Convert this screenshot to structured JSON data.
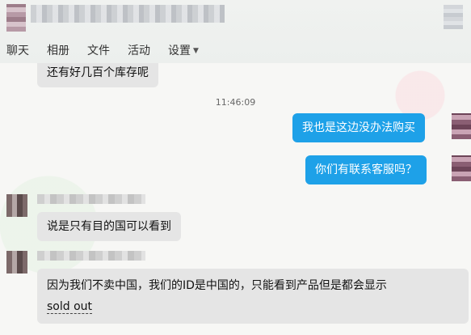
{
  "tabs": [
    "聊天",
    "相册",
    "文件",
    "活动",
    "设置"
  ],
  "time": "11:46:09",
  "messages": {
    "m1": "还有好几百个库存呢",
    "m2": "我也是这边没办法购买",
    "m3": "你们有联系客服吗？",
    "m4": "说是只有目的国可以看到",
    "m5_line1": "因为我们不卖中国，我们的ID是中国的，只能看到产品但是都会显示",
    "m5_line2": "sold out"
  },
  "colors": {
    "accent": "#2d8ee0",
    "right_bubble": "#1ea1e8",
    "left_bubble": "#e5e5e5"
  }
}
